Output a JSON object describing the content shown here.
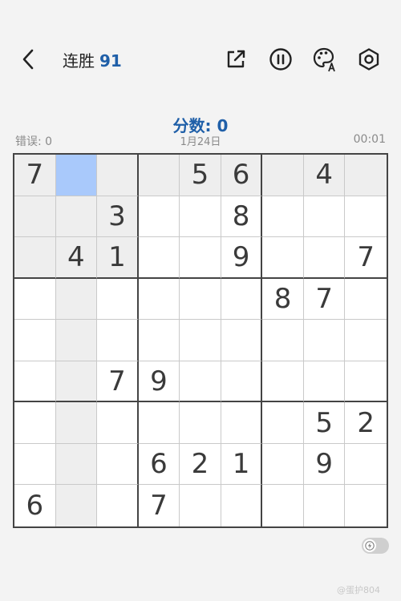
{
  "header": {
    "streak_label": "连胜",
    "streak_count": "91",
    "icons": [
      "back-icon",
      "share-icon",
      "pause-icon",
      "theme-palette-icon",
      "settings-icon"
    ]
  },
  "score_label": "分数: 0",
  "info": {
    "mistakes": "错误: 0",
    "date": "1月24日",
    "timer": "00:01"
  },
  "board": {
    "selected": [
      0,
      1
    ],
    "cells": [
      [
        "7",
        "",
        "",
        "",
        "5",
        "6",
        "",
        "4",
        ""
      ],
      [
        "",
        "",
        "3",
        "",
        "",
        "8",
        "",
        "",
        ""
      ],
      [
        "",
        "4",
        "1",
        "",
        "",
        "9",
        "",
        "",
        "7"
      ],
      [
        "",
        "",
        "",
        "",
        "",
        "",
        "8",
        "7",
        ""
      ],
      [
        "",
        "",
        "",
        "",
        "",
        "",
        "",
        "",
        ""
      ],
      [
        "",
        "",
        "7",
        "9",
        "",
        "",
        "",
        "",
        ""
      ],
      [
        "",
        "",
        "",
        "",
        "",
        "",
        "",
        "5",
        "2"
      ],
      [
        "",
        "",
        "",
        "6",
        "2",
        "1",
        "",
        "9",
        ""
      ],
      [
        "6",
        "",
        "",
        "7",
        "",
        "",
        "",
        "",
        ""
      ]
    ]
  },
  "watermark": "@蛋护804",
  "colors": {
    "accent": "#1f5fa8",
    "selected_cell": "#a9c9fb",
    "highlight_cell": "#eeeeee",
    "background": "#f3f3f3"
  }
}
